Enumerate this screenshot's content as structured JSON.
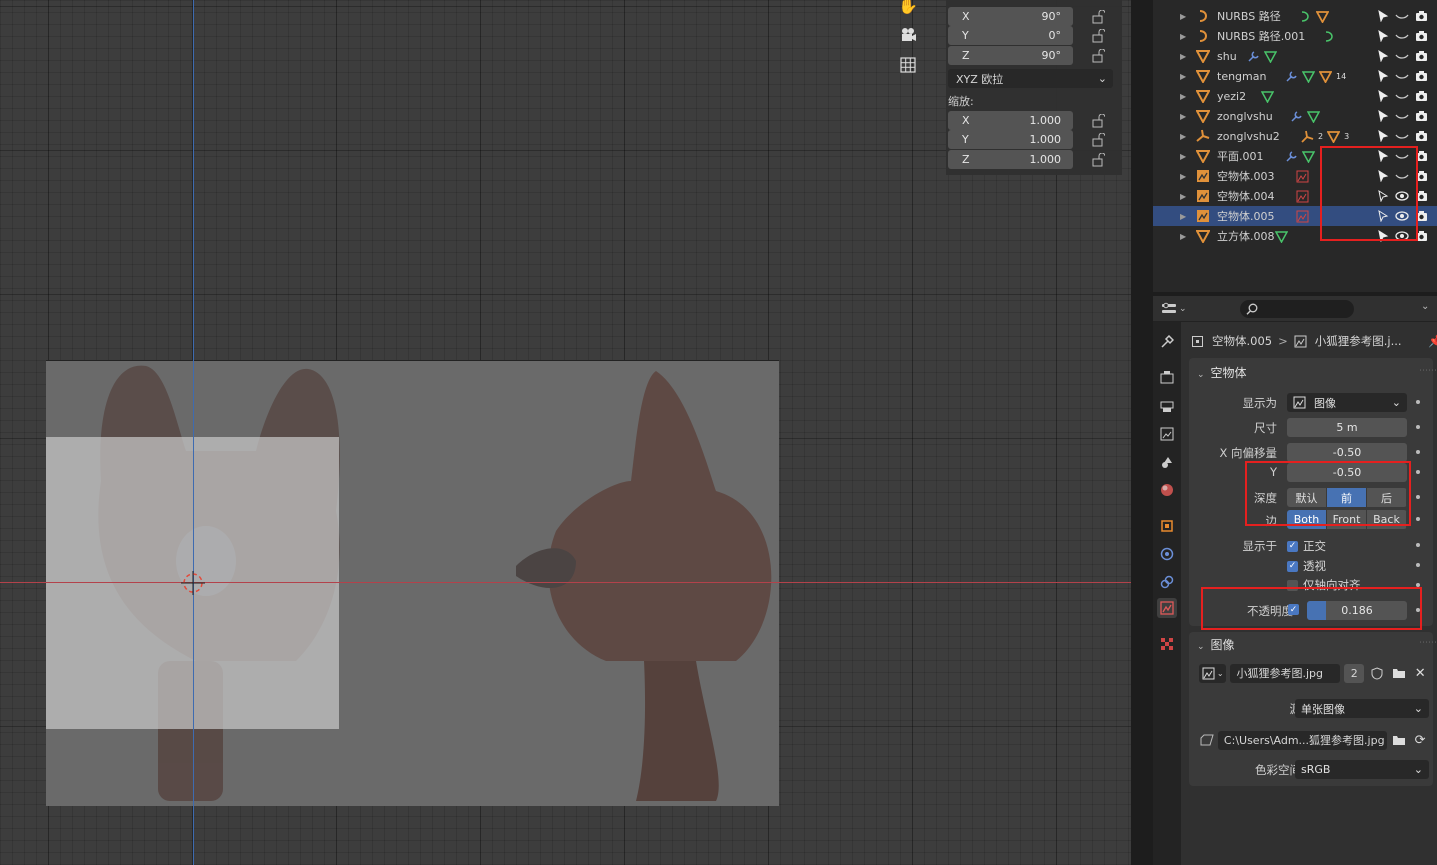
{
  "viewport": {
    "gizmo_icons": [
      "hand-pan-icon",
      "camera-icon",
      "grid-icon"
    ]
  },
  "npanel": {
    "rotation": [
      {
        "axis": "X",
        "value": "90°"
      },
      {
        "axis": "Y",
        "value": "0°"
      },
      {
        "axis": "Z",
        "value": "90°"
      }
    ],
    "rotation_mode": "XYZ 欧拉",
    "scale_label": "缩放:",
    "scale": [
      {
        "axis": "X",
        "value": "1.000"
      },
      {
        "axis": "Y",
        "value": "1.000"
      },
      {
        "axis": "Z",
        "value": "1.000"
      }
    ]
  },
  "outliner": {
    "rows": [
      {
        "name": "NURBS 路径",
        "type": "curve"
      },
      {
        "name": "NURBS 路径.001",
        "type": "curve"
      },
      {
        "name": "shu",
        "type": "mesh"
      },
      {
        "name": "tengman",
        "type": "mesh",
        "badge": "14"
      },
      {
        "name": "yezi2",
        "type": "mesh"
      },
      {
        "name": "zonglvshu",
        "type": "mesh"
      },
      {
        "name": "zonglvshu2",
        "type": "armature",
        "badge": "2",
        "badge2": "3"
      },
      {
        "name": "平面.001",
        "type": "mesh"
      },
      {
        "name": "空物体.003",
        "type": "empty-image"
      },
      {
        "name": "空物体.004",
        "type": "empty-image"
      },
      {
        "name": "空物体.005",
        "type": "empty-image",
        "selected": true
      },
      {
        "name": "立方体.008",
        "type": "mesh"
      }
    ]
  },
  "properties": {
    "breadcrumb_object": "空物体.005",
    "breadcrumb_data": "小狐狸参考图.j...",
    "empty_panel": {
      "title": "空物体",
      "display_as_label": "显示为",
      "display_as_value": "图像",
      "size_label": "尺寸",
      "size_value": "5 m",
      "offset_x_label": "X 向偏移量",
      "offset_x_value": "-0.50",
      "offset_y_label": "Y",
      "offset_y_value": "-0.50",
      "depth_label": "深度",
      "depth_options": [
        "默认",
        "前",
        "后"
      ],
      "depth_selected": 1,
      "side_label": "边",
      "side_options": [
        "Both",
        "Front",
        "Back"
      ],
      "side_selected": 0,
      "show_in_label": "显示于",
      "show_ortho": "正交",
      "show_persp": "透视",
      "show_axis_aligned": "仅轴向对齐",
      "opacity_label": "不透明度",
      "opacity_value": "0.186",
      "opacity_fraction": 0.186
    },
    "image_panel": {
      "title": "图像",
      "image_name": "小狐狸参考图.jpg",
      "users": "2",
      "source_label": "源",
      "source_value": "单张图像",
      "filepath": "C:\\Users\\Adm...狐狸参考图.jpg",
      "colorspace_label": "色彩空间",
      "colorspace_value": "sRGB"
    }
  },
  "colors": {
    "accent_blue": "#4772b3",
    "selection_row": "#334d80",
    "highlight_red": "#e5201f",
    "axis_red": "#b3424b",
    "axis_blue": "#3e6bb0"
  }
}
